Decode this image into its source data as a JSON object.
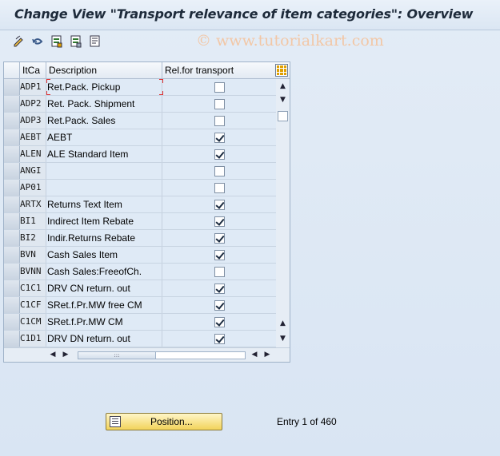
{
  "window": {
    "title": "Change View \"Transport relevance of item categories\": Overview"
  },
  "watermark": "© www.tutorialkart.com",
  "toolbar": {
    "icons": [
      "edit-pencil-icon",
      "undo-icon",
      "table-select-icon",
      "table-deselect-icon",
      "table-print-icon"
    ]
  },
  "table": {
    "columns": {
      "code": "ItCa",
      "description": "Description",
      "relevant": "Rel.for transport"
    },
    "rows": [
      {
        "code": "ADP1",
        "description": "Ret.Pack. Pickup",
        "checked": false
      },
      {
        "code": "ADP2",
        "description": "Ret. Pack. Shipment",
        "checked": false
      },
      {
        "code": "ADP3",
        "description": "Ret.Pack. Sales",
        "checked": false
      },
      {
        "code": "AEBT",
        "description": "AEBT",
        "checked": true
      },
      {
        "code": "ALEN",
        "description": "ALE Standard Item",
        "checked": true
      },
      {
        "code": "ANGI",
        "description": "",
        "checked": false
      },
      {
        "code": "AP01",
        "description": "",
        "checked": false
      },
      {
        "code": "ARTX",
        "description": "Returns Text Item",
        "checked": true
      },
      {
        "code": "BI1",
        "description": "Indirect Item Rebate",
        "checked": true
      },
      {
        "code": "BI2",
        "description": "Indir.Returns Rebate",
        "checked": true
      },
      {
        "code": "BVN",
        "description": "Cash Sales Item",
        "checked": true
      },
      {
        "code": "BVNN",
        "description": "Cash Sales:FreeofCh.",
        "checked": false
      },
      {
        "code": "C1C1",
        "description": "DRV CN return. out",
        "checked": true
      },
      {
        "code": "C1CF",
        "description": "SRet.f.Pr.MW free CM",
        "checked": true
      },
      {
        "code": "C1CM",
        "description": "SRet.f.Pr.MW CM",
        "checked": true
      },
      {
        "code": "C1D1",
        "description": "DRV DN return. out",
        "checked": true
      }
    ]
  },
  "footer": {
    "position_button": "Position...",
    "entry_text": "Entry 1 of 460"
  }
}
